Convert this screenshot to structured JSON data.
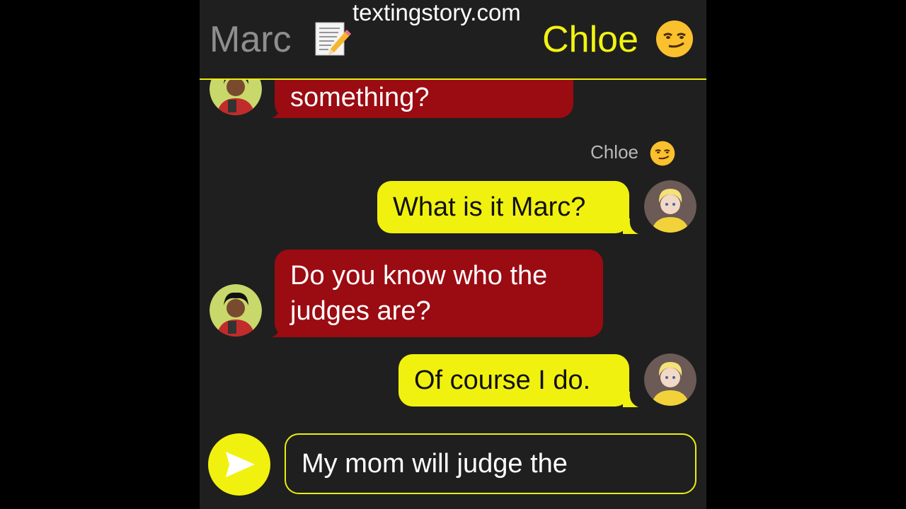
{
  "watermark": "textingstory.com",
  "header": {
    "left_name": "Marc",
    "left_icon": "notepad-pencil-icon",
    "right_name": "Chloe",
    "right_icon": "smirk-emoji-icon"
  },
  "colors": {
    "accent_yellow": "#f1f10f",
    "incoming_red": "#9b0b12",
    "background": "#1f1f1f"
  },
  "sender_label": "Chloe",
  "messages": [
    {
      "from": "Marc",
      "text": "something?"
    },
    {
      "from": "Chloe",
      "text": "What is it Marc?"
    },
    {
      "from": "Marc",
      "lines": [
        "Do you know who the",
        "judges are?"
      ]
    },
    {
      "from": "Chloe",
      "text": "Of course I do."
    }
  ],
  "composer": {
    "draft_text": "My mom will judge the",
    "send_icon": "send-arrow-icon"
  }
}
